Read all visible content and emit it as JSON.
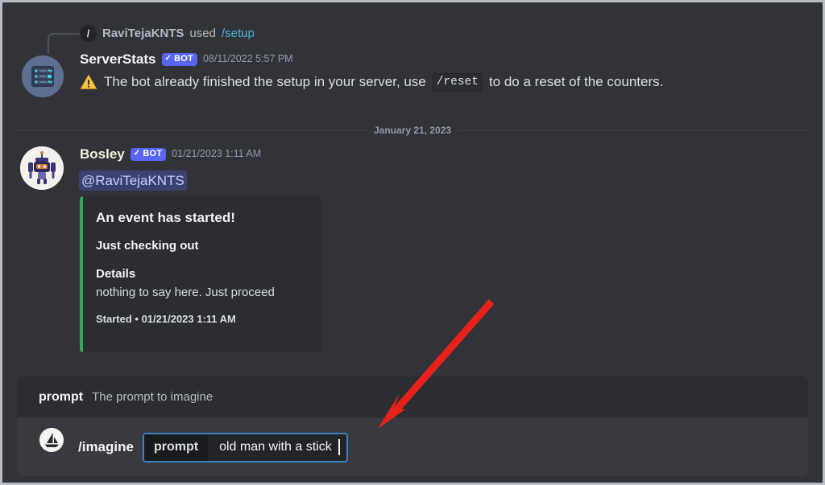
{
  "window": {
    "border_color": "#b9bcc2",
    "background": "#313338"
  },
  "command_used": {
    "icon": "slash-command-icon",
    "glyph": "/",
    "user": "RaviTejaKNTS",
    "verb": "used",
    "command": "/setup"
  },
  "messages": [
    {
      "author": "ServerStats",
      "bot_label": "BOT",
      "bot_check": "✓",
      "timestamp": "08/11/2022 5:57 PM",
      "avatar": "serverstats-avatar",
      "body_prefix": "The bot already finished the setup in your server, use",
      "body_code": "/reset",
      "body_suffix": "to do a reset of the counters.",
      "warning_icon": "warning-triangle-icon"
    },
    {
      "author": "Bosley",
      "bot_label": "BOT",
      "bot_check": "✓",
      "timestamp": "01/21/2023 1:11 AM",
      "avatar": "bosley-robot-avatar",
      "mention": "@RaviTejaKNTS",
      "embed": {
        "accent_color": "#3ba55c",
        "title": "An event has started!",
        "subtitle": "Just checking out",
        "field_name": "Details",
        "field_value": "nothing to say here. Just proceed",
        "footer": "Started • 01/21/2023 1:11 AM"
      }
    }
  ],
  "date_divider": {
    "label": "January 21, 2023"
  },
  "composer": {
    "hint": {
      "key": "prompt",
      "description": "The prompt to imagine"
    },
    "app_icon": "midjourney-sailboat-icon",
    "command": "/imagine",
    "option_chip": "prompt",
    "option_value": "old man with a stick",
    "focus_color": "#3f7fbf"
  },
  "annotation": {
    "arrow_color": "#e8221b",
    "name": "red-pointer-arrow"
  }
}
